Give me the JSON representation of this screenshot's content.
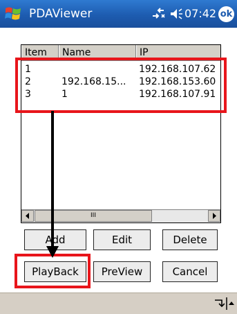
{
  "titlebar": {
    "title": "PDAViewer",
    "time": "07:42",
    "ok_label": "ok"
  },
  "table": {
    "headers": [
      "Item",
      "Name",
      "IP"
    ],
    "rows": [
      {
        "item": "1",
        "name": "",
        "ip": "192.168.107.62"
      },
      {
        "item": "2",
        "name": "192.168.15...",
        "ip": "192.168.153.60"
      },
      {
        "item": "3",
        "name": "1",
        "ip": "192.168.107.91"
      }
    ],
    "scroll_thumb": "III"
  },
  "buttons": {
    "add": "Add",
    "edit": "Edit",
    "delete": "Delete",
    "playback": "PlayBack",
    "preview": "PreView",
    "cancel": "Cancel"
  },
  "colors": {
    "titlebar": "#1d5cb0",
    "annotation": "#e8151b"
  },
  "icons": [
    "windows-logo-icon",
    "connectivity-icon",
    "volume-icon",
    "ok-icon",
    "keyboard-icon",
    "up-arrow-icon"
  ]
}
